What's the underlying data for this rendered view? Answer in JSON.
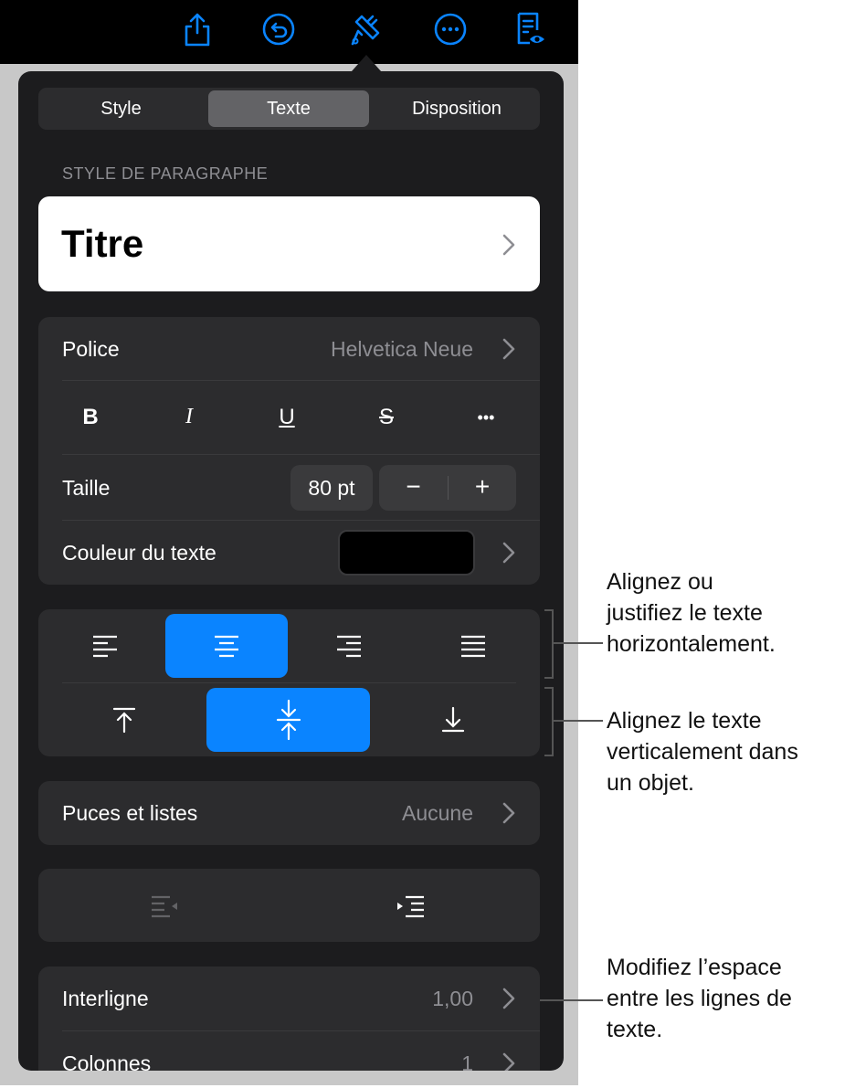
{
  "toolbar": {
    "icons": [
      "share-icon",
      "undo-icon",
      "paintbrush-icon",
      "more-icon",
      "reader-view-icon"
    ]
  },
  "tabs": [
    {
      "label": "Style",
      "active": false
    },
    {
      "label": "Texte",
      "active": true
    },
    {
      "label": "Disposition",
      "active": false
    }
  ],
  "paragraph_style": {
    "section_label": "STYLE DE PARAGRAPHE",
    "value": "Titre"
  },
  "font": {
    "label": "Police",
    "value": "Helvetica Neue",
    "format_buttons": [
      "B",
      "I",
      "U",
      "S",
      "•••"
    ],
    "size_label": "Taille",
    "size_value": "80 pt",
    "decrement": "−",
    "increment": "+",
    "color_label": "Couleur du texte",
    "color_value": "#000000"
  },
  "alignment": {
    "horizontal": [
      "align-left-icon",
      "align-center-icon",
      "align-right-icon",
      "justify-icon"
    ],
    "horizontal_selected": "align-center-icon",
    "vertical": [
      "align-top-icon",
      "align-middle-icon",
      "align-bottom-icon"
    ],
    "vertical_selected": "align-middle-icon",
    "accent": "#0a84ff"
  },
  "bullets": {
    "label": "Puces et listes",
    "value": "Aucune"
  },
  "indent": {
    "buttons": [
      "decrease-indent-icon",
      "increase-indent-icon"
    ]
  },
  "spacing": {
    "line_label": "Interligne",
    "line_value": "1,00",
    "columns_label": "Colonnes",
    "columns_value": "1"
  },
  "callouts": {
    "horizontal": "Alignez ou\njustifiez le texte\nhorizontalement.",
    "vertical": "Alignez le texte\nverticalement dans\nun objet.",
    "spacing": "Modifiez l’espace\nentre les lignes de\ntexte."
  }
}
